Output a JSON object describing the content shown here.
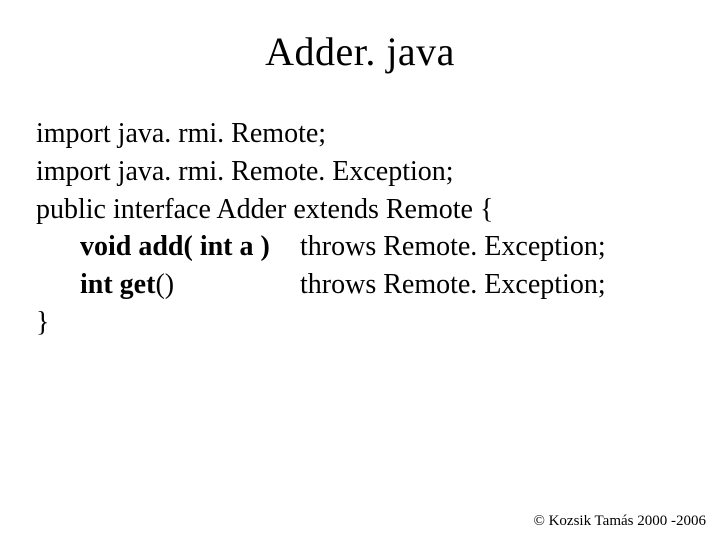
{
  "title": "Adder. java",
  "code": {
    "l1": "import java. rmi. Remote;",
    "l2": "import java. rmi. Remote. Exception;",
    "l3": "public interface Adder extends Remote {",
    "m1_sig_bold": "void add( int a )",
    "m1_throws": "  throws Remote. Exception;",
    "m2_sig_bold": "int get",
    "m2_sig_tail": "()",
    "m2_throws": "throws Remote. Exception;",
    "l6": "}"
  },
  "footer": "© Kozsik Tamás 2000 -2006"
}
